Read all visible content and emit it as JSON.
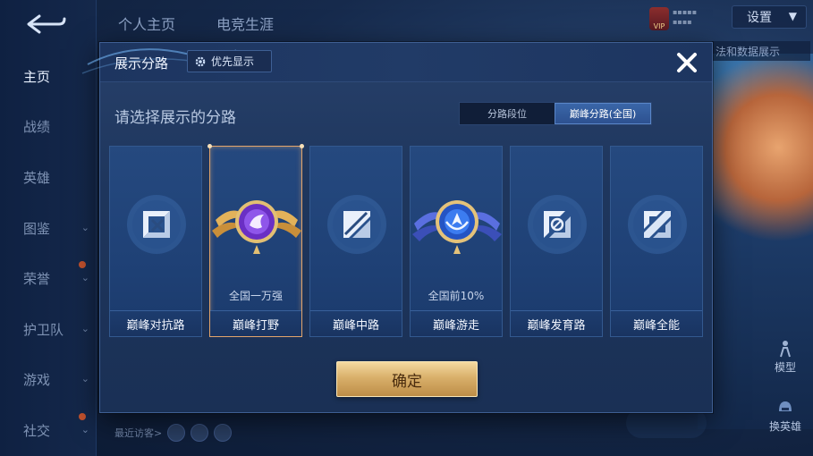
{
  "background": {
    "left_nav": {
      "items": [
        {
          "label": "主页",
          "active": true,
          "chevron": false,
          "dot": false
        },
        {
          "label": "战绩",
          "active": false,
          "chevron": false,
          "dot": false
        },
        {
          "label": "英雄",
          "active": false,
          "chevron": false,
          "dot": false
        },
        {
          "label": "图鉴",
          "active": false,
          "chevron": true,
          "dot": false
        },
        {
          "label": "荣誉",
          "active": false,
          "chevron": true,
          "dot": true
        },
        {
          "label": "护卫队",
          "active": false,
          "chevron": true,
          "dot": false
        },
        {
          "label": "游戏",
          "active": false,
          "chevron": true,
          "dot": false
        },
        {
          "label": "社交",
          "active": false,
          "chevron": true,
          "dot": true
        }
      ]
    },
    "top_tabs": [
      "个人主页",
      "电竞生涯"
    ],
    "vip_label": "VIP",
    "settings_label": "设置",
    "side_text": "法和数据展示",
    "right_buttons": {
      "model": "模型",
      "switch_hero": "换英雄"
    },
    "recent_visitors_label": "最近访客>"
  },
  "dialog": {
    "title": "展示分路",
    "priority_button": "优先显示",
    "subtitle": "请选择展示的分路",
    "toggle": {
      "options": [
        "分路段位",
        "巅峰分路(全国)"
      ],
      "active_index": 1
    },
    "cards": [
      {
        "label": "巅峰对抗路",
        "icon": "sword-lane-icon",
        "rank": "",
        "selected": false
      },
      {
        "label": "巅峰打野",
        "icon": "purple-badge-icon",
        "rank": "全国一万强",
        "selected": true
      },
      {
        "label": "巅峰中路",
        "icon": "slash-lane-icon",
        "rank": "",
        "selected": false
      },
      {
        "label": "巅峰游走",
        "icon": "blue-badge-icon",
        "rank": "全国前10%",
        "selected": false
      },
      {
        "label": "巅峰发育路",
        "icon": "target-lane-icon",
        "rank": "",
        "selected": false
      },
      {
        "label": "巅峰全能",
        "icon": "allround-lane-icon",
        "rank": "",
        "selected": false
      }
    ],
    "confirm_button": "确定"
  },
  "colors": {
    "dialog_bg": "#1e365d",
    "card_bg": "#23467c",
    "selected_border": "#e3a56b",
    "confirm_gold": "#d9b06b",
    "toggle_active": "#3a66a8"
  }
}
